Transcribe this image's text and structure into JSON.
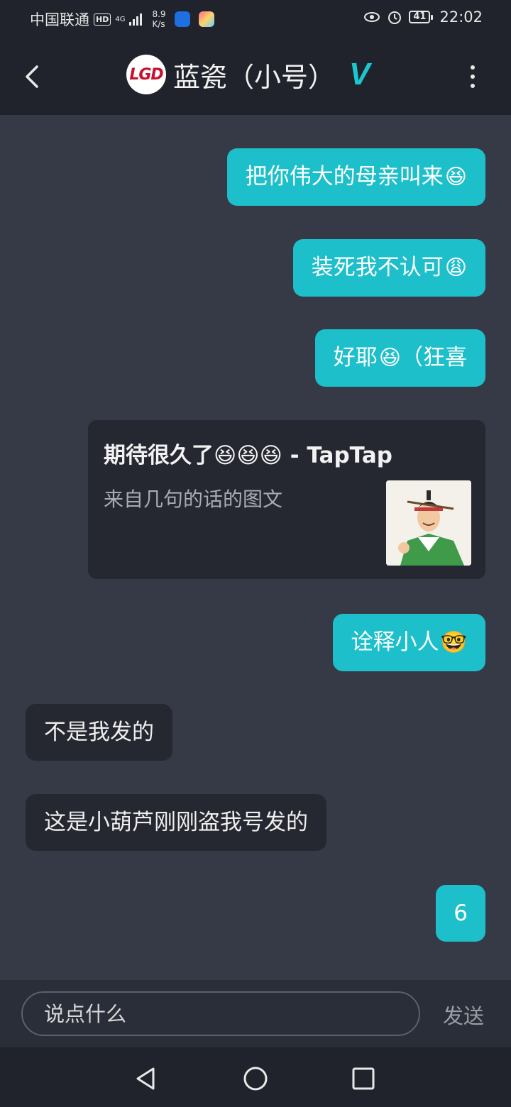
{
  "status_bar": {
    "carrier": "中国联通",
    "hd": "HD",
    "network": "4G",
    "speed_value": "8.9",
    "speed_unit": "K/s",
    "battery": "41",
    "time": "22:02"
  },
  "header": {
    "logo_text": "LGD",
    "title": "蓝瓷（小号）",
    "badge": "V"
  },
  "messages": [
    {
      "side": "out",
      "text": "把你伟大的母亲叫来",
      "emoji": "😆"
    },
    {
      "side": "out",
      "text": "装死我不认可",
      "emoji": "😩"
    },
    {
      "side": "out",
      "text": "好耶",
      "emoji": "😆",
      "suffix": "（狂喜"
    },
    {
      "side": "out",
      "text": "诠释小人",
      "emoji": "🤓"
    },
    {
      "side": "in",
      "text": "不是我发的"
    },
    {
      "side": "in",
      "text": "这是小葫芦刚刚盗我号发的"
    },
    {
      "side": "out",
      "text": "6"
    }
  ],
  "share_card": {
    "title": "期待很久了",
    "title_emojis": "😆😆😆",
    "title_suffix": " - TapTap",
    "subtitle": "来自几句的话的图文"
  },
  "input": {
    "placeholder": "说点什么",
    "send_label": "发送"
  },
  "colors": {
    "background": "#353a46",
    "bar": "#20232b",
    "outgoing_bubble": "#1cbfca",
    "incoming_bubble": "#252831",
    "accent": "#1cc6d0"
  }
}
